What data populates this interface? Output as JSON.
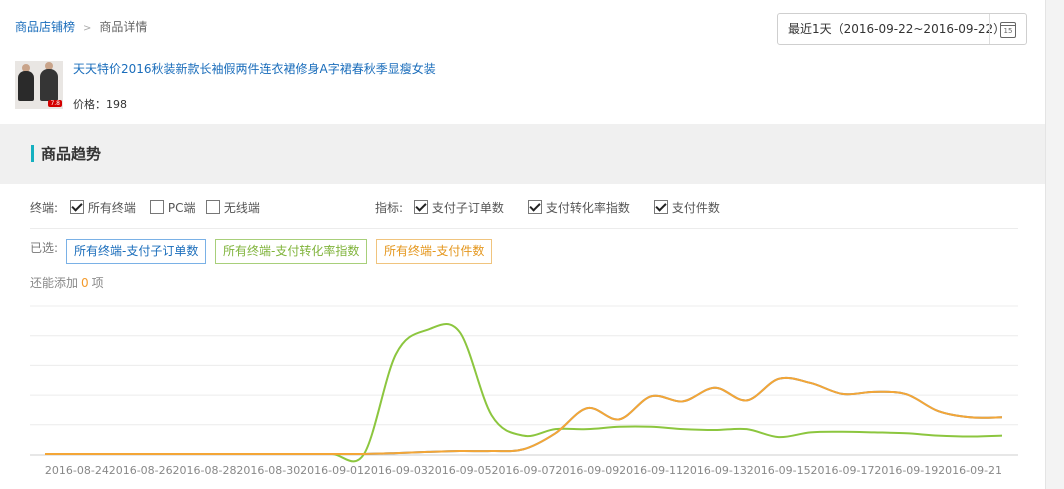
{
  "breadcrumb": {
    "parent": "商品店铺榜",
    "current": "商品详情"
  },
  "date_range": {
    "label": "最近1天（2016-09-22~2016-09-22）",
    "calendar_day": "15"
  },
  "product": {
    "title": "天天特价2016秋装新款长袖假两件连衣裙修身A字裙春秋季显瘦女装",
    "price": "价格：198",
    "thumb_badge": "7.8"
  },
  "section": {
    "title": "商品趋势"
  },
  "filters": {
    "terminal_label": "终端:",
    "terminals": [
      {
        "label": "所有终端",
        "checked": true
      },
      {
        "label": "PC端",
        "checked": false
      },
      {
        "label": "无线端",
        "checked": false
      }
    ],
    "metric_label": "指标:",
    "metrics": [
      {
        "label": "支付子订单数",
        "checked": true
      },
      {
        "label": "支付转化率指数",
        "checked": true
      },
      {
        "label": "支付件数",
        "checked": true
      }
    ]
  },
  "selected": {
    "label": "已选:",
    "tags": [
      "所有终端-支付子订单数",
      "所有终端-支付转化率指数",
      "所有终端-支付件数"
    ],
    "can_add_prefix": "还能添加",
    "can_add_count": "0",
    "can_add_suffix": "项"
  },
  "colors": {
    "blue": "#4a87c8",
    "green": "#8cc63f",
    "orange": "#f4a636",
    "accent": "#15b0c0"
  },
  "chart_data": {
    "type": "line",
    "x_tick_labels": [
      "2016-08-24",
      "2016-08-26",
      "2016-08-28",
      "2016-08-30",
      "2016-09-01",
      "2016-09-03",
      "2016-09-05",
      "2016-09-07",
      "2016-09-09",
      "2016-09-11",
      "2016-09-13",
      "2016-09-15",
      "2016-09-17",
      "2016-09-19",
      "2016-09-21"
    ],
    "x": [
      "08-23",
      "08-24",
      "08-25",
      "08-26",
      "08-27",
      "08-28",
      "08-29",
      "08-30",
      "08-31",
      "09-01",
      "09-02",
      "09-03",
      "09-04",
      "09-05",
      "09-06",
      "09-07",
      "09-08",
      "09-09",
      "09-10",
      "09-11",
      "09-12",
      "09-13",
      "09-14",
      "09-15",
      "09-16",
      "09-17",
      "09-18",
      "09-19",
      "09-20",
      "09-21",
      "09-22"
    ],
    "grid": true,
    "series": [
      {
        "color": "#4a87c8",
        "values": [
          0,
          0,
          0,
          0,
          0,
          0,
          0,
          0,
          0,
          0,
          0,
          0.3,
          0.7,
          1,
          1,
          1.6,
          7,
          15.5,
          11.7,
          19.5,
          17.8,
          22.4,
          18.1,
          25.4,
          24,
          20.3,
          21,
          20.2,
          14.5,
          12.4,
          12.4
        ]
      },
      {
        "color": "#8cc63f",
        "values": [
          0,
          0,
          0,
          0,
          0,
          0,
          0,
          0,
          0,
          0,
          0,
          33.7,
          42,
          41.2,
          13.1,
          6.2,
          8.4,
          8.4,
          9.2,
          9.2,
          8.4,
          8.1,
          8.4,
          5.7,
          7.3,
          7.5,
          7.3,
          7,
          6.2,
          5.9,
          6.2
        ]
      },
      {
        "color": "#f4a636",
        "values": [
          0,
          0,
          0,
          0,
          0,
          0,
          0,
          0,
          0,
          0,
          0,
          0.3,
          0.7,
          1,
          1,
          1.6,
          7,
          15.5,
          11.7,
          19.5,
          17.8,
          22.4,
          18.1,
          25.4,
          24,
          20.3,
          21,
          20.2,
          14.5,
          12.4,
          12.4
        ]
      }
    ]
  }
}
